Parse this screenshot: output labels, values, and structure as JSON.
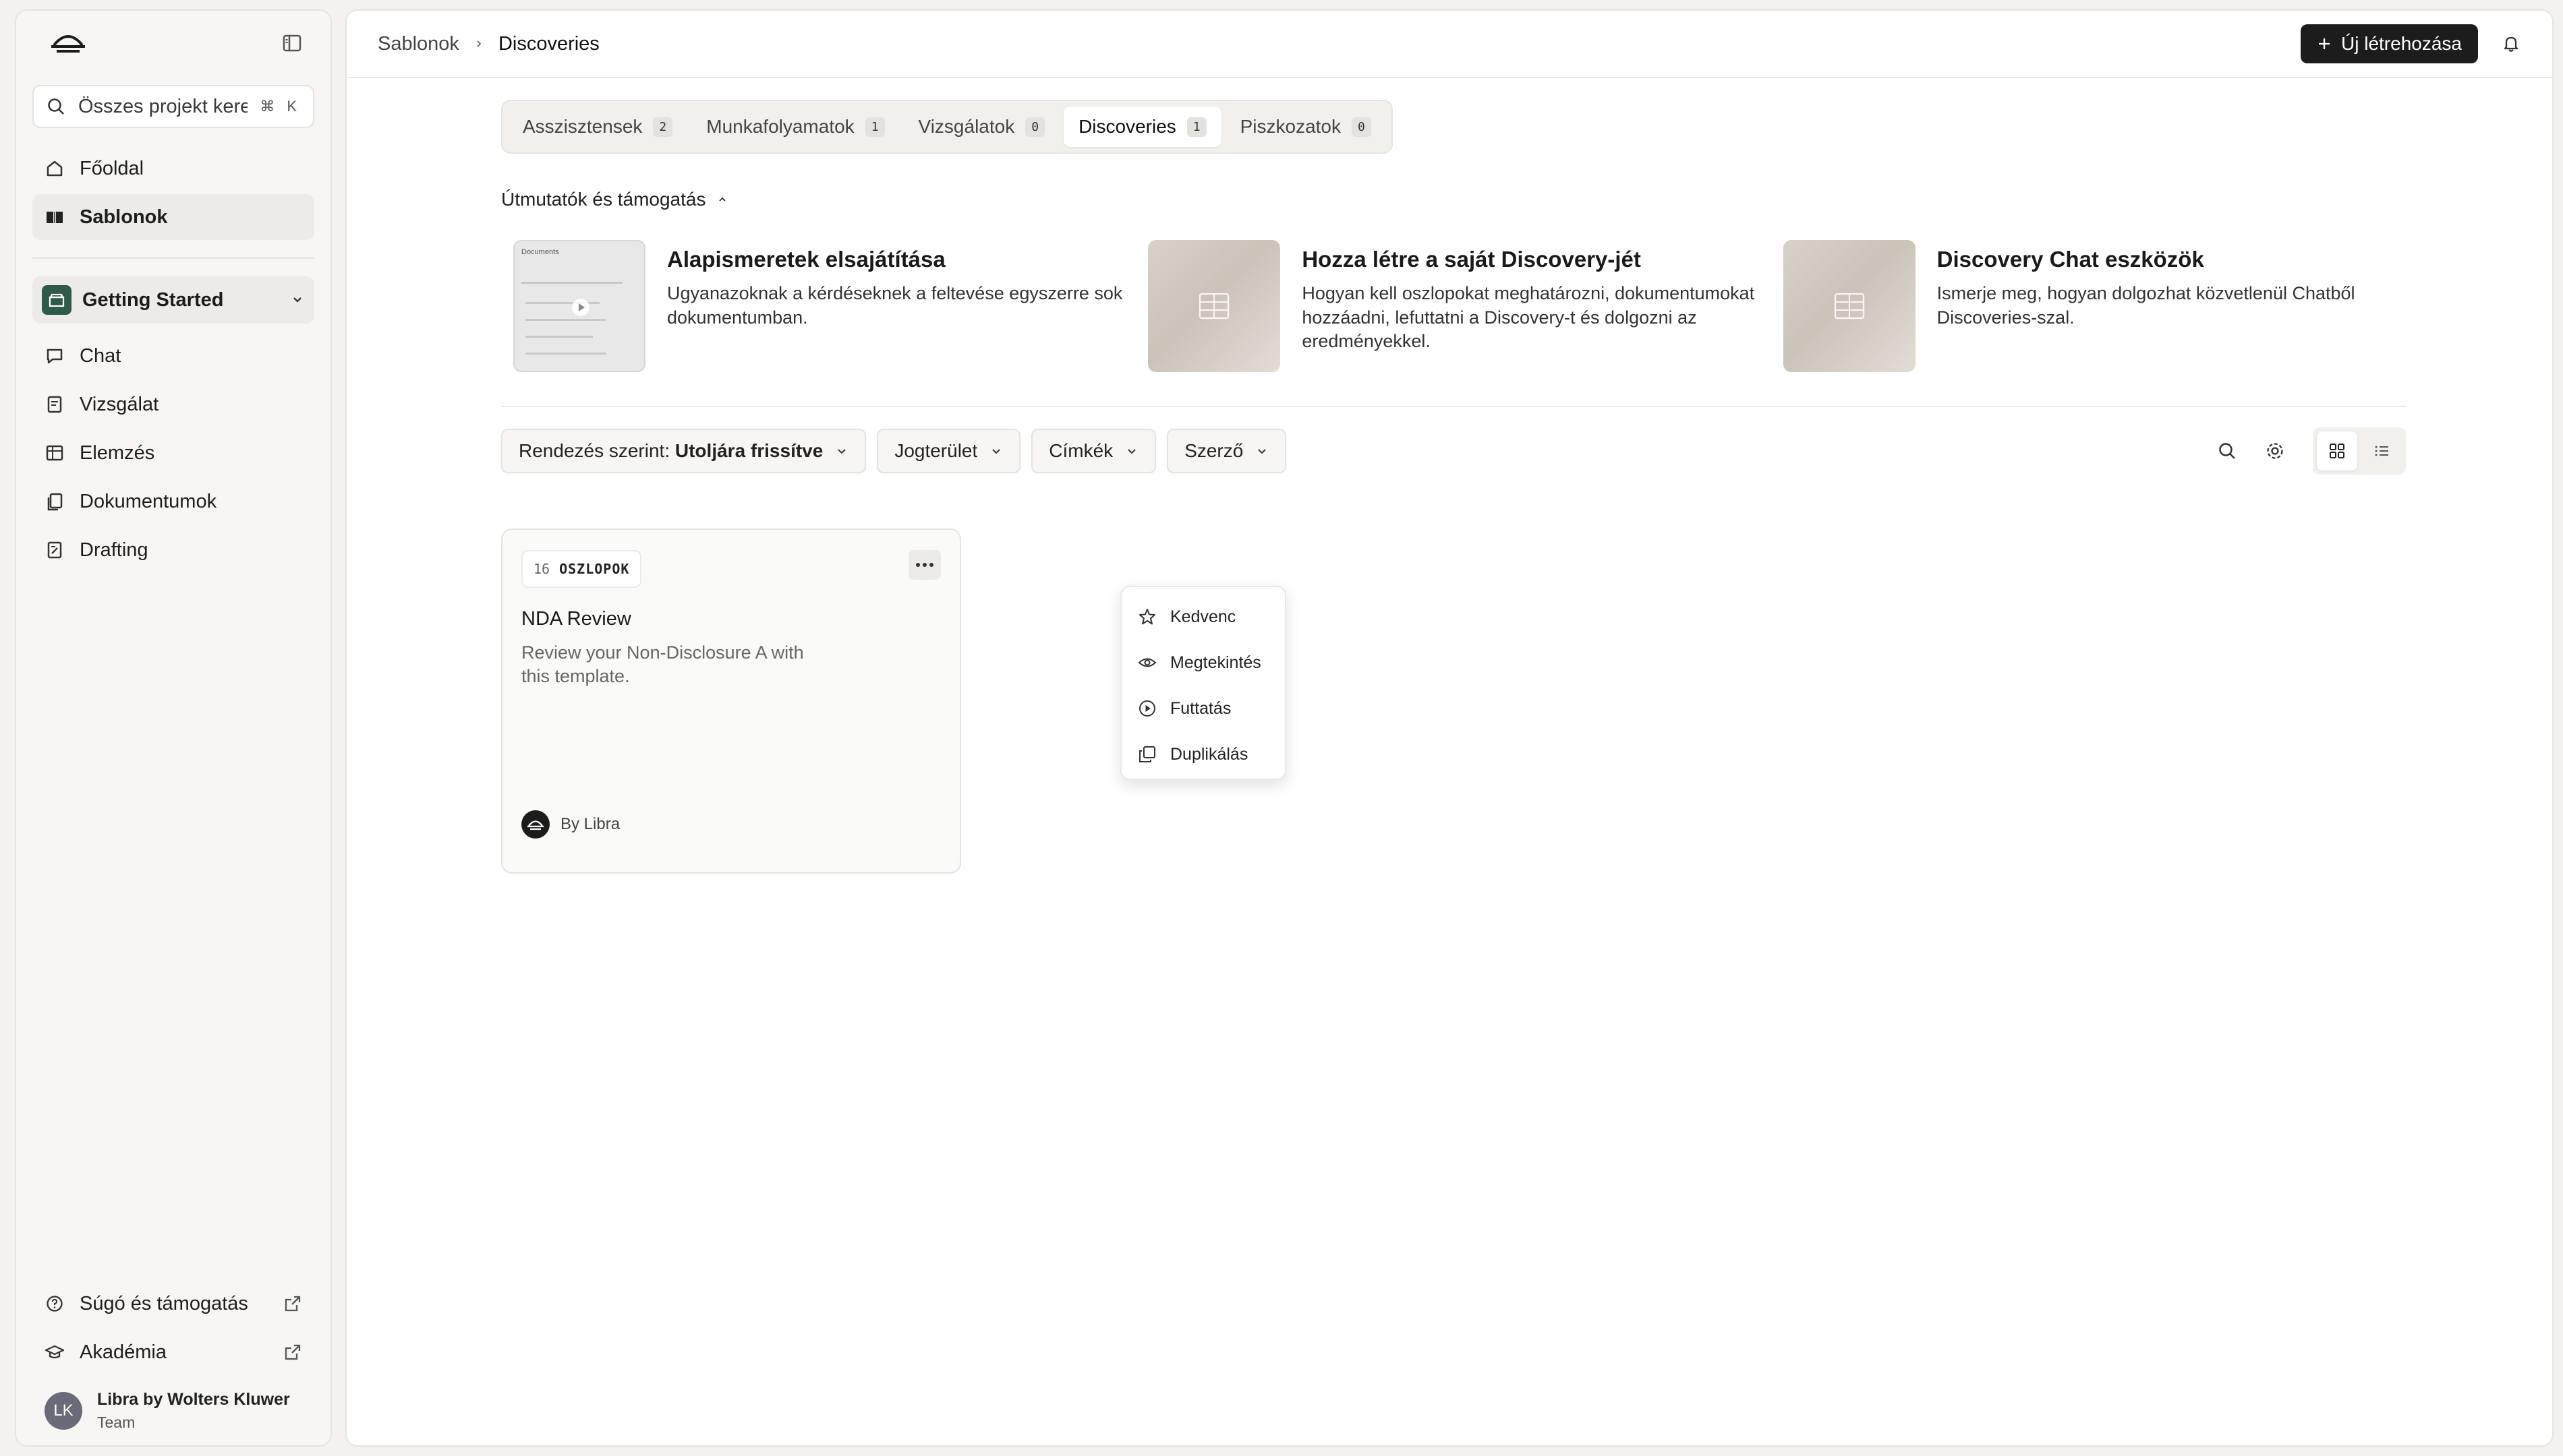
{
  "sidebar": {
    "search": {
      "placeholder": "Összes projekt kere...",
      "shortcut": "⌘ K"
    },
    "nav": [
      {
        "label": "Főoldal",
        "icon": "home-icon"
      },
      {
        "label": "Sablonok",
        "icon": "book-icon",
        "active": true
      }
    ],
    "project": {
      "name": "Getting Started"
    },
    "project_nav": [
      {
        "label": "Chat",
        "icon": "chat-icon"
      },
      {
        "label": "Vizsgálat",
        "icon": "file-icon"
      },
      {
        "label": "Elemzés",
        "icon": "table-icon"
      },
      {
        "label": "Dokumentumok",
        "icon": "documents-icon"
      },
      {
        "label": "Drafting",
        "icon": "drafting-icon"
      }
    ],
    "bottom": [
      {
        "label": "Súgó és támogatás",
        "icon": "help-icon"
      },
      {
        "label": "Akadémia",
        "icon": "academy-icon"
      }
    ],
    "user": {
      "initials": "LK",
      "name": "Libra by Wolters Kluwer",
      "team": "Team"
    }
  },
  "header": {
    "breadcrumb": [
      "Sablonok",
      "Discoveries"
    ],
    "new_button": "Új létrehozása"
  },
  "tabs": [
    {
      "label": "Asszisztensek",
      "count": "2"
    },
    {
      "label": "Munkafolyamatok",
      "count": "1"
    },
    {
      "label": "Vizsgálatok",
      "count": "0"
    },
    {
      "label": "Discoveries",
      "count": "1",
      "active": true
    },
    {
      "label": "Piszkozatok",
      "count": "0"
    }
  ],
  "guides": {
    "heading": "Útmutatók és támogatás",
    "items": [
      {
        "title": "Alapismeretek elsajátítása",
        "desc": "Ugyanazoknak a kérdéseknek a feltevése egyszerre sok dokumentumban."
      },
      {
        "title": "Hozza létre a saját Discovery-jét",
        "desc": "Hogyan kell oszlopokat meghatározni, dokumentumokat hozzáadni, lefuttatni a Discovery-t és dolgozni az eredményekkel."
      },
      {
        "title": "Discovery Chat eszközök",
        "desc": "Ismerje meg, hogyan dolgozhat közvetlenül Chatből Discoveries-szal."
      }
    ],
    "thumb_text": "Documents"
  },
  "filters": {
    "sort_label": "Rendezés szerint:",
    "sort_value": "Utoljára frissítve",
    "jurisdiction": "Jogterület",
    "tags": "Címkék",
    "author": "Szerző"
  },
  "card": {
    "columns_count": "16",
    "columns_label": "OSZLOPOK",
    "title": "NDA Review",
    "desc": "Review your Non-Disclosure A with this template.",
    "by": "By Libra"
  },
  "menu": [
    {
      "label": "Kedvenc",
      "icon": "star-icon"
    },
    {
      "label": "Megtekintés",
      "icon": "eye-icon"
    },
    {
      "label": "Futtatás",
      "icon": "play-icon"
    },
    {
      "label": "Duplikálás",
      "icon": "duplicate-icon"
    }
  ],
  "colors": {
    "accent": "#1c1c1c",
    "project": "#2f5a45"
  }
}
